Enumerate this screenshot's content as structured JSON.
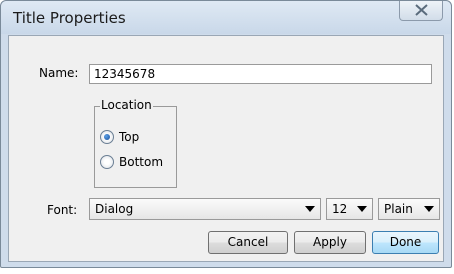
{
  "window": {
    "title": "Title Properties"
  },
  "form": {
    "name_label": "Name:",
    "name_value": "12345678",
    "location": {
      "legend": "Location",
      "options": [
        {
          "label": "Top",
          "checked": true
        },
        {
          "label": "Bottom",
          "checked": false
        }
      ]
    },
    "font_label": "Font:",
    "font_family": "Dialog",
    "font_size": "12",
    "font_style": "Plain"
  },
  "buttons": {
    "cancel": "Cancel",
    "apply": "Apply",
    "done": "Done"
  },
  "icons": {
    "close": "close-icon",
    "dropdown": "chevron-down-icon"
  },
  "colors": {
    "title_bar": "#c9d8e9",
    "client_bg": "#f0f0f0",
    "default_button": "#bee6fd",
    "radio_selected": "#1a4f9a"
  }
}
